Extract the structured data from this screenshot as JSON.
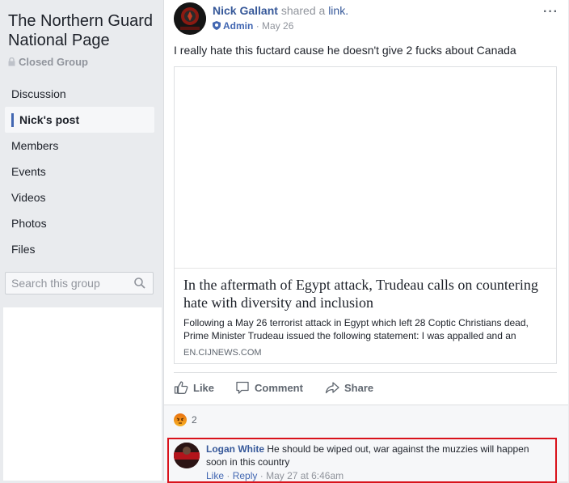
{
  "group": {
    "title": "The Northern Guard National Page",
    "type": "Closed Group"
  },
  "nav": {
    "items": [
      {
        "label": "Discussion"
      },
      {
        "label": "Nick's post"
      },
      {
        "label": "Members"
      },
      {
        "label": "Events"
      },
      {
        "label": "Videos"
      },
      {
        "label": "Photos"
      },
      {
        "label": "Files"
      }
    ],
    "active_index": 1
  },
  "search": {
    "placeholder": "Search this group"
  },
  "post": {
    "author": "Nick Gallant",
    "action": "shared a",
    "link_word": "link.",
    "role": "Admin",
    "date": "May 26",
    "more": "···",
    "text": "I really hate this fuctard cause he doesn't give 2 fucks about Canada",
    "link": {
      "headline": "In the aftermath of Egypt attack, Trudeau calls on countering hate with diversity and inclusion",
      "description": "Following a May 26 terrorist attack in Egypt which left 28 Coptic Christians dead, Prime Minister Trudeau issued the following statement: I was appalled and an",
      "domain": "EN.CIJNEWS.COM"
    },
    "actions": {
      "like": "Like",
      "comment": "Comment",
      "share": "Share"
    },
    "reaction_count": "2"
  },
  "comment": {
    "author": "Logan White",
    "text": "He should be wiped out, war against the muzzies will happen soon in this country",
    "like": "Like",
    "reply": "Reply",
    "time": "May 27 at 6:46am"
  },
  "colors": {
    "link_blue": "#365899",
    "highlight_red": "#d9121b",
    "angry_orange": "#e9710f"
  }
}
